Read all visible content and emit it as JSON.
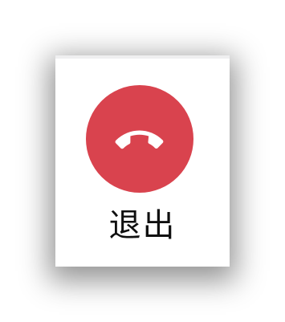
{
  "call_controls": {
    "exit": {
      "label": "退出",
      "icon": "phone-hangup-icon",
      "colors": {
        "button_bg": "#d9434e",
        "icon_fg": "#ffffff"
      }
    }
  }
}
